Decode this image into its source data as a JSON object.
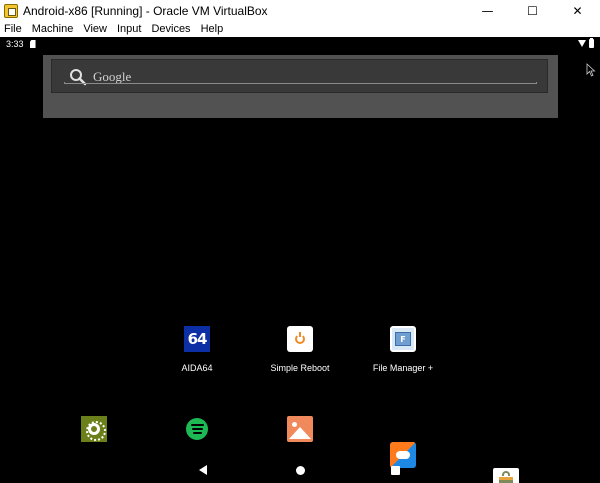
{
  "window": {
    "title": "Android-x86 [Running] - Oracle VM VirtualBox",
    "controls": {
      "minimize": "—",
      "maximize": "☐",
      "close": "✕"
    }
  },
  "menubar": {
    "items": [
      "File",
      "Machine",
      "View",
      "Input",
      "Devices",
      "Help"
    ]
  },
  "android": {
    "status": {
      "time": "3:33",
      "icons": [
        "sd-card-icon",
        "wifi-icon",
        "battery-icon"
      ]
    },
    "search": {
      "placeholder": "Google"
    },
    "apps": [
      {
        "label": "AIDA64",
        "icon_text": "64",
        "icon": "aida64-icon"
      },
      {
        "label": "Simple Reboot",
        "icon": "reboot-icon"
      },
      {
        "label": "File Manager +",
        "icon_text": "F",
        "icon": "file-manager-icon"
      }
    ],
    "dock": [
      {
        "icon": "settings-icon",
        "color": "#6b7f1a"
      },
      {
        "icon": "spotify-icon",
        "color": "#1db954"
      },
      {
        "icon": "gallery-icon",
        "color": "#f08a5d"
      },
      {
        "icon": "file-transfer-icon",
        "color": "#1e88e5"
      },
      {
        "icon": "market-icon",
        "color": "#7d8a5a"
      }
    ],
    "nav": [
      "back-icon",
      "home-icon",
      "recents-icon"
    ]
  }
}
